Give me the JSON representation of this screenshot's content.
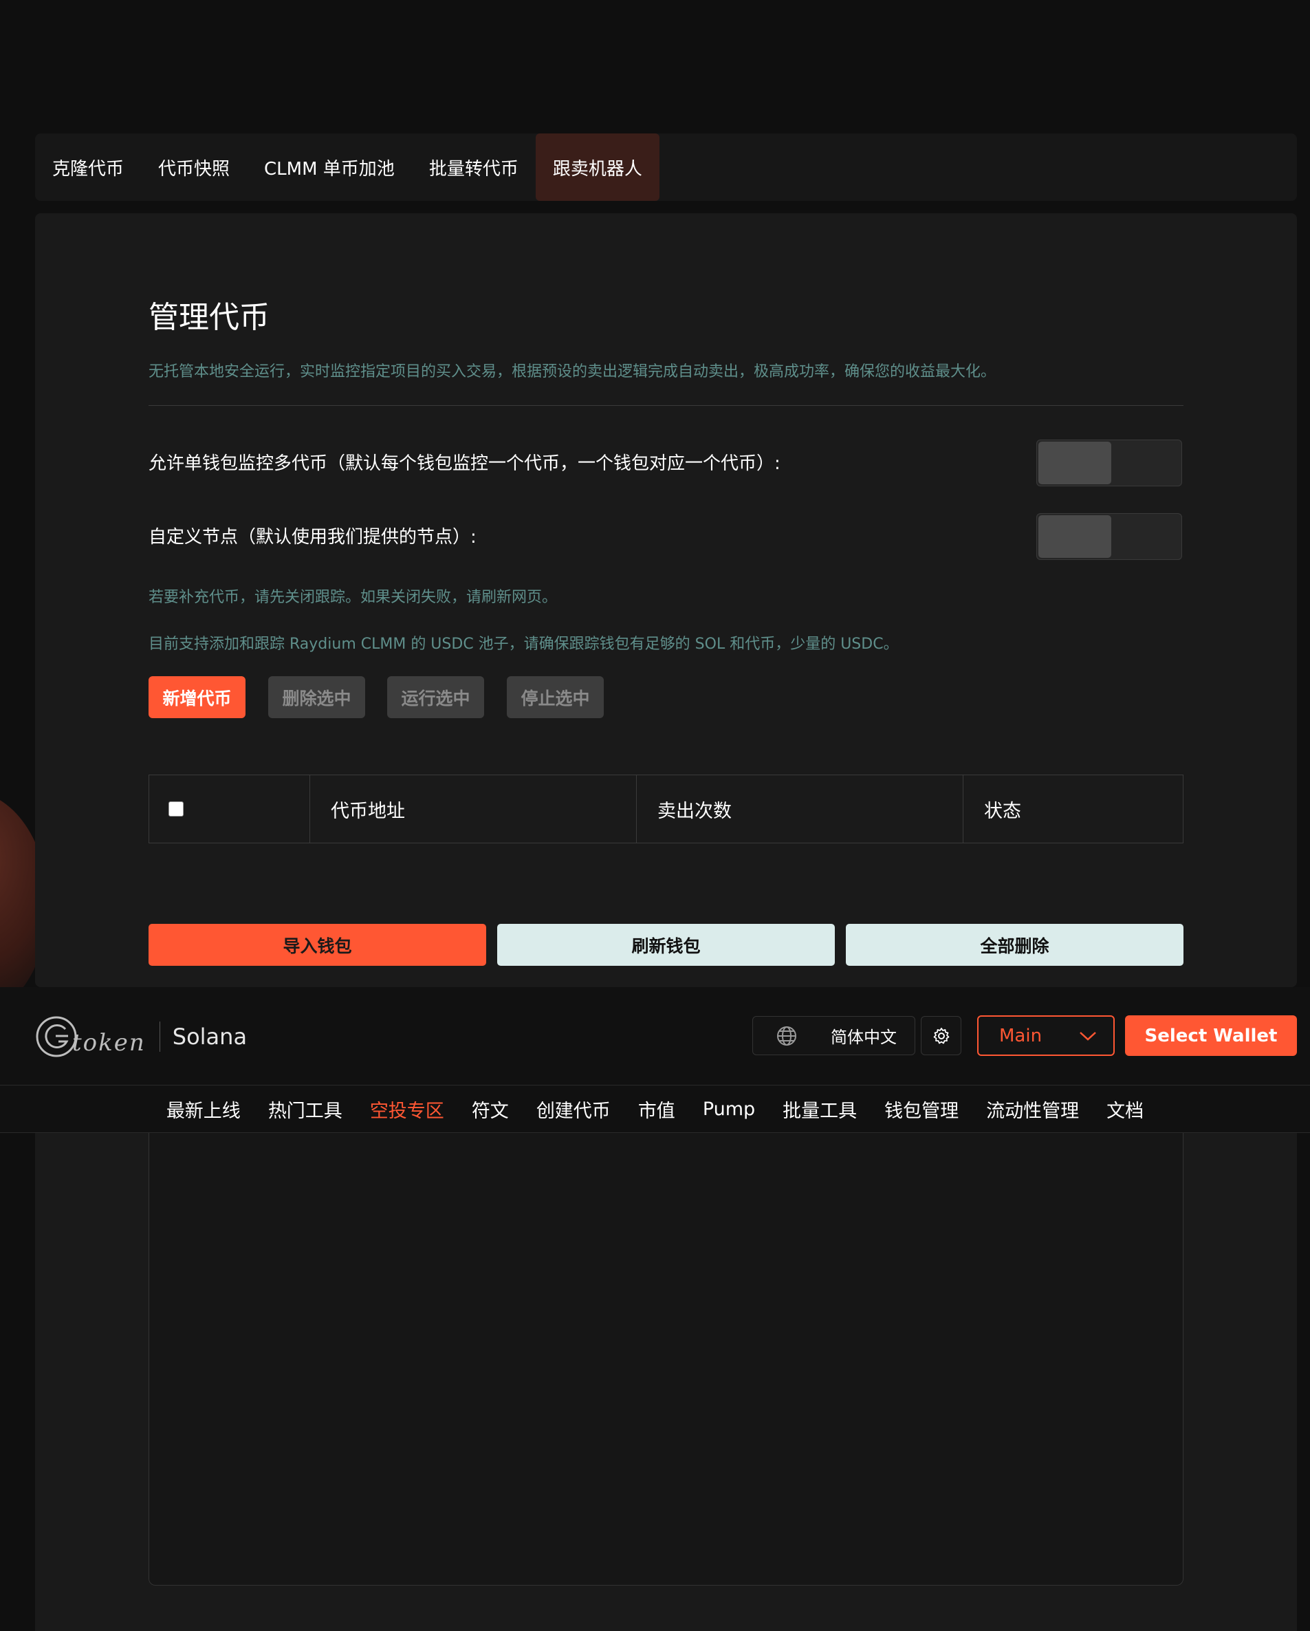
{
  "tabs": [
    {
      "label": "克隆代币"
    },
    {
      "label": "代币快照"
    },
    {
      "label": "CLMM 单币加池"
    },
    {
      "label": "批量转代币"
    },
    {
      "label": "跟卖机器人",
      "active": true
    }
  ],
  "main": {
    "title": "管理代币",
    "description": "无托管本地安全运行，实时监控指定项目的买入交易，根据预设的卖出逻辑完成自动卖出，极高成功率，确保您的收益最大化。",
    "option_multi": "允许单钱包监控多代币（默认每个钱包监控一个代币，一个钱包对应一个代币）:",
    "option_node": "自定义节点（默认使用我们提供的节点）:",
    "note1": "若要补充代币，请先关闭跟踪。如果关闭失败，请刷新网页。",
    "note2": "目前支持添加和跟踪 Raydium CLMM 的 USDC 池子，请确保跟踪钱包有足够的 SOL 和代币，少量的 USDC。",
    "actions": {
      "add": "新增代币",
      "delete": "删除选中",
      "run": "运行选中",
      "stop": "停止选中"
    },
    "table_headers": [
      "代币地址",
      "卖出次数",
      "状态"
    ],
    "wallet_actions": {
      "import": "导入钱包",
      "refresh": "刷新钱包",
      "delete_all": "全部删除"
    }
  },
  "header": {
    "logo_text": "token",
    "chain": "Solana",
    "language": "简体中文",
    "network": "Main",
    "select_wallet": "Select Wallet"
  },
  "nav": [
    {
      "label": "最新上线"
    },
    {
      "label": "热门工具"
    },
    {
      "label": "空投专区",
      "active": true
    },
    {
      "label": "符文"
    },
    {
      "label": "创建代币"
    },
    {
      "label": "市值"
    },
    {
      "label": "Pump"
    },
    {
      "label": "批量工具"
    },
    {
      "label": "钱包管理"
    },
    {
      "label": "流动性管理"
    },
    {
      "label": "文档"
    }
  ],
  "colors": {
    "accent": "#ff5733",
    "teal_text": "#5f8f8b",
    "background": "#0f0f0f",
    "panel": "#1a1a1a"
  }
}
